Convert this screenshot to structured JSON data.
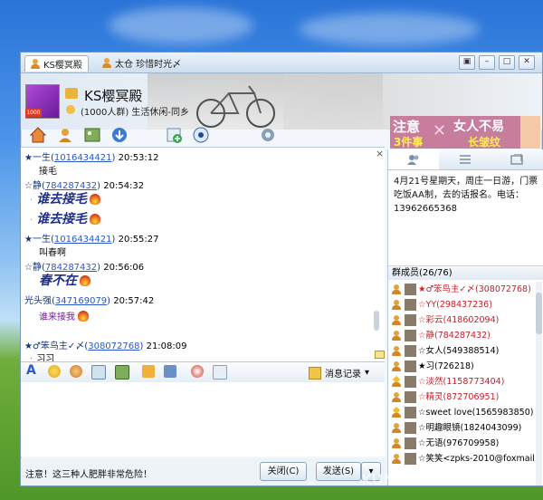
{
  "tabs": [
    {
      "label": "KS樱冥殿",
      "active": true
    },
    {
      "label": "太仓 珍惜时光〆",
      "active": false
    }
  ],
  "window_controls": [
    "▣",
    "–",
    "□",
    "✕"
  ],
  "header": {
    "group_name": "KS樱冥殿",
    "group_sub": "(1000人群) 生活休闲-同乡",
    "avatar_badge": "1000",
    "colors": {
      "avatar": "#8c2bc0"
    }
  },
  "ad": {
    "left_top": "注意",
    "left_bottom": "3件事",
    "right_top": "女人不易",
    "right_bottom": "长皱纹"
  },
  "toolbar_icons": [
    "home-icon",
    "person-icon",
    "photo-icon",
    "share-icon",
    "blank-icon",
    "add-icon",
    "eye-icon",
    "settings-icon"
  ],
  "chat": {
    "close": "×",
    "messages": [
      {
        "prefix": "★一生(",
        "id": "1016434421",
        "suffix": ")",
        "time": "20:53:12",
        "body": "接毛",
        "style": "plain"
      },
      {
        "prefix": "☆静(",
        "id": "784287432",
        "suffix": ")",
        "time": "20:54:32",
        "body": "谁去接毛",
        "style": "big",
        "dot": "·"
      },
      {
        "prefix": "",
        "id": "",
        "suffix": "",
        "time": "",
        "body": "谁去接毛",
        "style": "big",
        "dot": "·"
      },
      {
        "prefix": "★一生(",
        "id": "1016434421",
        "suffix": ")",
        "time": "20:55:27",
        "body": "叫春啊",
        "style": "plain"
      },
      {
        "prefix": "☆静(",
        "id": "784287432",
        "suffix": ")",
        "time": "20:56:06",
        "body": "春不在",
        "style": "big"
      },
      {
        "prefix": "光头强(",
        "id": "347169079",
        "suffix": ")",
        "time": "20:57:42",
        "body": "谁来接我",
        "style": "purple"
      },
      {
        "prefix": "★♂笨鸟主✓〆(",
        "id": "308072768",
        "suffix": ")",
        "time": "21:08:09",
        "body": "习习",
        "style": "plain",
        "dot": "·"
      }
    ]
  },
  "input_toolbar": {
    "font_icon": "A",
    "history_label": "消息记录",
    "history_arrow": "▾"
  },
  "bottom": {
    "warning": "注意！这三种人肥胖非常危险！",
    "close_label": "关闭(C)",
    "send_label": "发送(S)",
    "send_arrow": "▾"
  },
  "right_panel": {
    "notice": "4月21号星期天，周庄一日游，门票吃饭AA制，去的话报名。电话：13962665368",
    "members_header": "群成员(26/76)",
    "members": [
      {
        "name": "★♂笨鸟主✓〆(308072768)",
        "color": "#c8202a",
        "star": false
      },
      {
        "name": "☆YY(298437236)",
        "color": "#c8202a",
        "star": false
      },
      {
        "name": "☆彩云(418602094)",
        "color": "#c8202a",
        "star": false
      },
      {
        "name": "☆静(784287432)",
        "color": "#c8202a",
        "star": false
      },
      {
        "name": "☆女人(549388514)",
        "color": "#111111",
        "star": false
      },
      {
        "name": "★习(726218)",
        "color": "#111111",
        "star": false
      },
      {
        "name": "☆淡然(1158773404)",
        "color": "#c8202a",
        "star": true
      },
      {
        "name": "☆精灵(872706951)",
        "color": "#c8202a",
        "star": false
      },
      {
        "name": "☆sweet love(1565983850)",
        "color": "#111111",
        "star": true
      },
      {
        "name": "☆明趣眼镜(1824043099)",
        "color": "#111111",
        "star": false
      },
      {
        "name": "☆无语(976709958)",
        "color": "#111111",
        "star": false
      },
      {
        "name": "☆笑笑<zpks-2010@foxmail",
        "color": "#111111",
        "star": false
      }
    ]
  },
  "watermark": "KUNSHAN BBS"
}
